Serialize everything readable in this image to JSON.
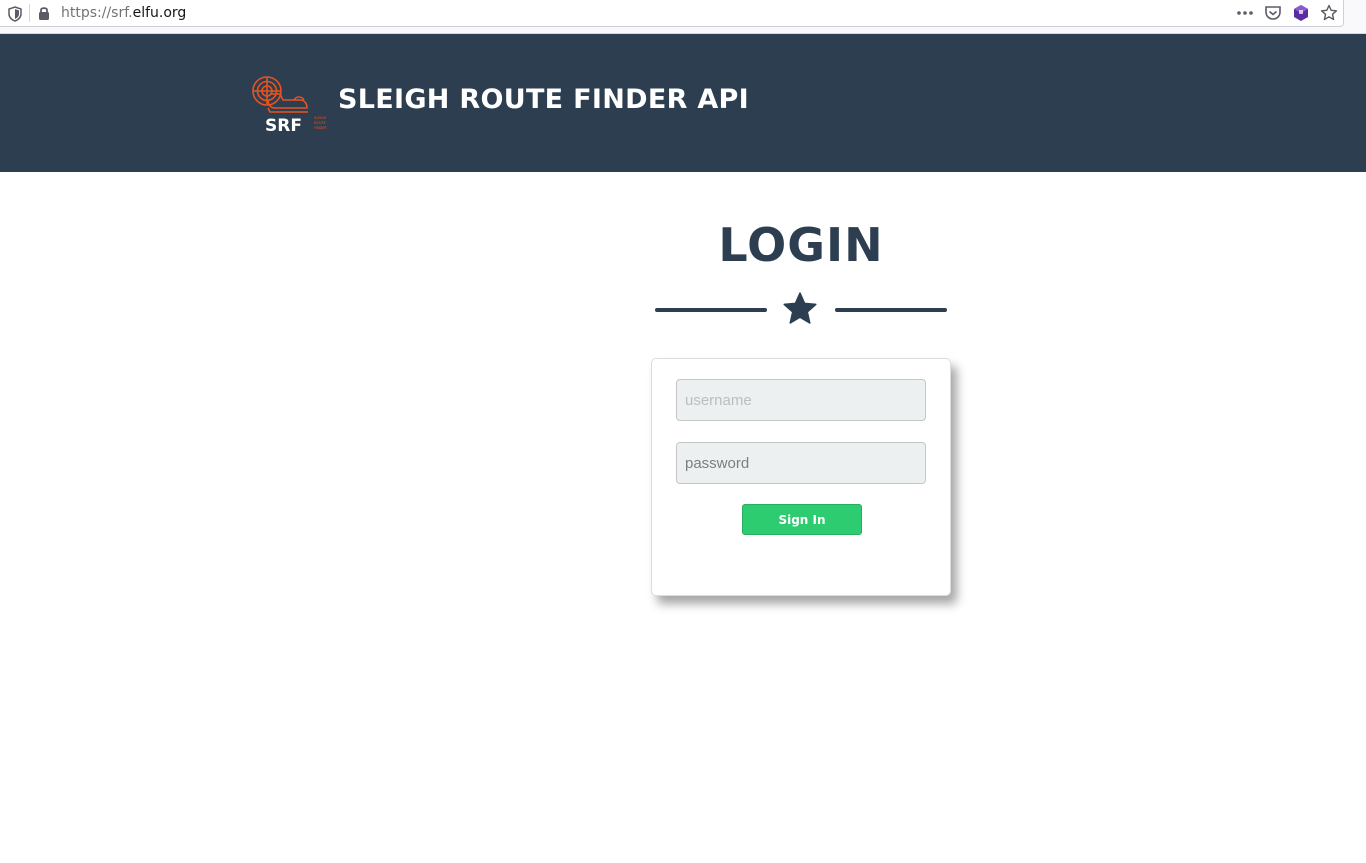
{
  "browser": {
    "url_prefix": "https://srf.",
    "url_host": "elfu.org",
    "icons": [
      "shield-icon",
      "lock-icon",
      "more-icon",
      "pocket-icon",
      "extension-icon",
      "bookmark-star-icon"
    ]
  },
  "header": {
    "logo_text": "SRF",
    "logo_small_text": [
      "SLEIGH",
      "ROUTE",
      "FINDER"
    ],
    "title": "SLEIGH ROUTE FINDER API",
    "background": "#2c3e50",
    "logo_color": "#e8531f"
  },
  "login": {
    "heading": "LOGIN",
    "username_placeholder": "username",
    "password_placeholder": "password",
    "signin_label": "Sign In",
    "button_color": "#2ecc71",
    "heading_color": "#2c3e50"
  }
}
